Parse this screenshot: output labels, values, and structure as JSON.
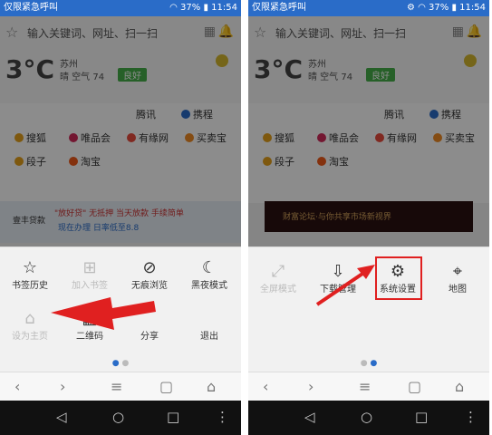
{
  "status": {
    "carrier": "仅限紧急呼叫",
    "battery": "37%",
    "time": "11:54"
  },
  "browser": {
    "url_placeholder": "输入关键词、网址、扫一扫",
    "weather": {
      "temp": "3°C",
      "city": "苏州",
      "air": "晴 空气 74",
      "quality": "良好"
    },
    "links": [
      "腾讯",
      "携程",
      "搜狐",
      "唯品会",
      "有缘网",
      "买卖宝",
      "段子",
      "淘宝"
    ]
  },
  "left": {
    "menu": [
      "书签历史",
      "加入书签",
      "无痕浏览",
      "黑夜模式",
      "设为主页",
      "二维码",
      "分享",
      "退出"
    ],
    "banner": {
      "logo": "壹丰贷款",
      "slogan": "\"放好贷\" 无抵押 当天放款 手续简单",
      "cta": "现在办理 日率低至8.8"
    }
  },
  "right": {
    "menu": [
      "全屏模式",
      "下载管理",
      "系统设置",
      "地图"
    ],
    "banner_text": "财富论坛·与你共享市场新视界"
  },
  "colors": {
    "accent": "#2a6cc8",
    "highlight": "#e02020",
    "arrow": "#e02020"
  }
}
